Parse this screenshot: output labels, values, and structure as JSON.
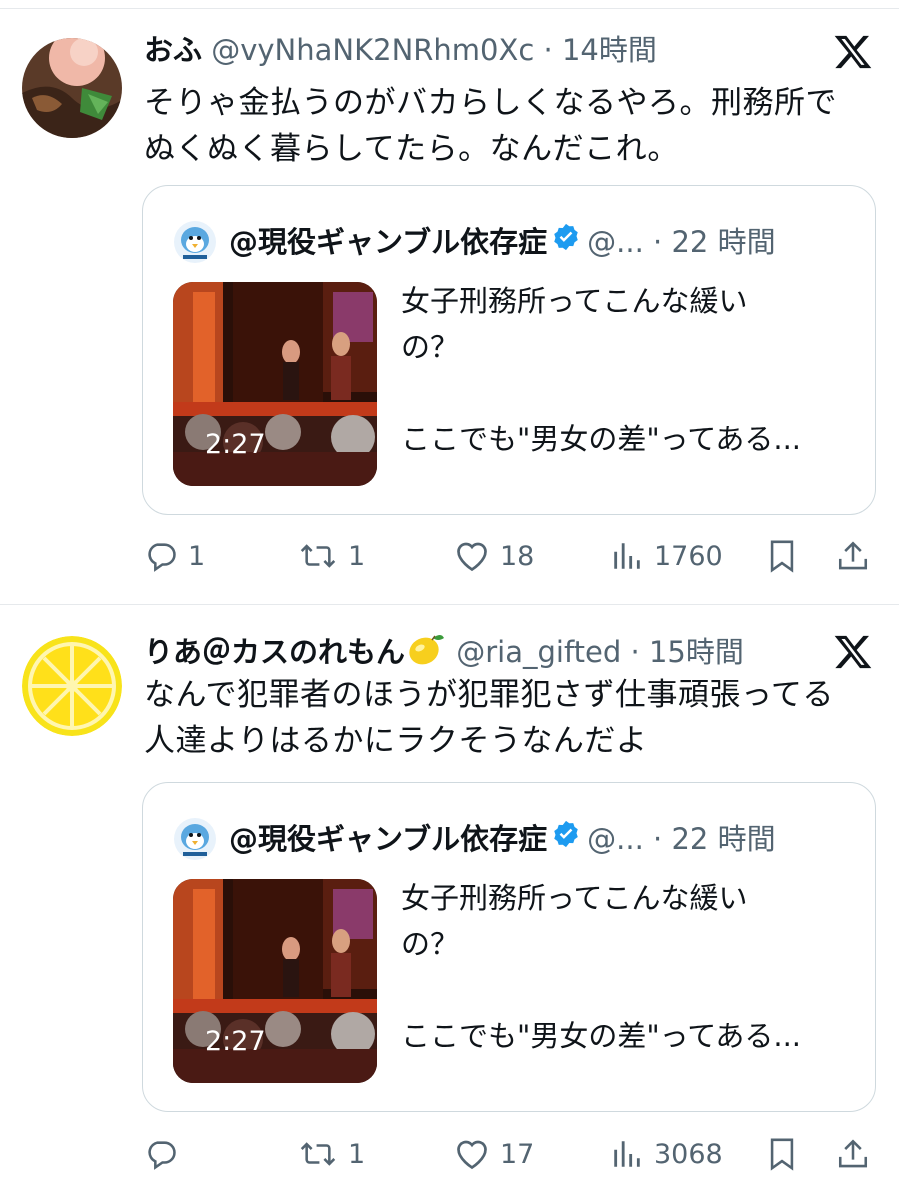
{
  "tweets": [
    {
      "name": "おふ",
      "handle": "@vyNhaNK2NRhm0Xc",
      "dot": "·",
      "time": "14時間",
      "text_lines": [
        "そりゃ金払うのがバカらしくなるやろ。刑務所で",
        "ぬくぬく暮らしてたら。なんだこれ。"
      ],
      "quote": {
        "name": "@現役ギャンブル依存症",
        "rest": "@... · 22 時間",
        "duration": "2:27",
        "text": "女子刑務所ってこんな緩い\nの？\n\nここでも\"男女の差\"ってある..."
      },
      "actions": {
        "replies": "1",
        "reposts": "1",
        "likes": "18",
        "views": "1760"
      }
    },
    {
      "name": "りあ＠カスのれもん",
      "emoji_icon": "lemon-emoji",
      "handle": "@ria_gifted",
      "dot": "·",
      "time": "15時間",
      "text_lines": [
        "なんで犯罪者のほうが犯罪犯さず仕事頑張ってる",
        "人達よりはるかにラクそうなんだよ"
      ],
      "quote": {
        "name": "@現役ギャンブル依存症",
        "rest": "@... · 22 時間",
        "duration": "2:27",
        "text": "女子刑務所ってこんな緩い\nの？\n\nここでも\"男女の差\"ってある..."
      },
      "actions": {
        "replies": "",
        "reposts": "1",
        "likes": "17",
        "views": "3068"
      }
    }
  ],
  "colors": {
    "text": "#0f1419",
    "secondary": "#536471",
    "border": "#cfd9de",
    "verified": "#1d9bf0"
  }
}
